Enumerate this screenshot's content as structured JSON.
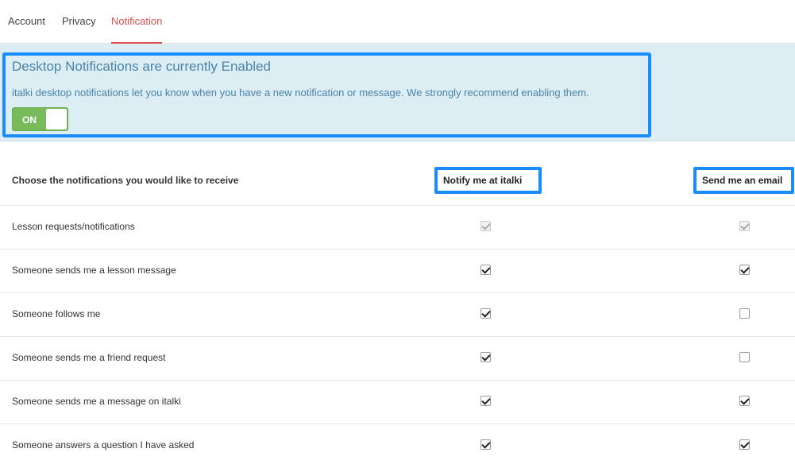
{
  "tabs": [
    {
      "label": "Account",
      "active": false
    },
    {
      "label": "Privacy",
      "active": false
    },
    {
      "label": "Notification",
      "active": true
    }
  ],
  "banner": {
    "title": "Desktop Notifications are currently Enabled",
    "description": "italki desktop notifications let you know when you have a new notification or message. We strongly recommend enabling them.",
    "toggle_label": "ON",
    "toggle_on": true
  },
  "table": {
    "header_label": "Choose the notifications you would like to receive",
    "col1_label": "Notify me at italki",
    "col2_label": "Send me an email",
    "rows": [
      {
        "label": "Lesson requests/notifications",
        "notify": true,
        "email": true,
        "disabled": true
      },
      {
        "label": "Someone sends me a lesson message",
        "notify": true,
        "email": true,
        "disabled": false
      },
      {
        "label": "Someone follows me",
        "notify": true,
        "email": false,
        "disabled": false
      },
      {
        "label": "Someone sends me a friend request",
        "notify": true,
        "email": false,
        "disabled": false
      },
      {
        "label": "Someone sends me a message on italki",
        "notify": true,
        "email": true,
        "disabled": false
      },
      {
        "label": "Someone answers a question I have asked",
        "notify": true,
        "email": true,
        "disabled": false
      }
    ]
  },
  "colors": {
    "accent_tab": "#d9534f",
    "highlight_box": "#1a8cff",
    "banner_bg": "#dcedf4",
    "toggle_on": "#77bb5a"
  }
}
